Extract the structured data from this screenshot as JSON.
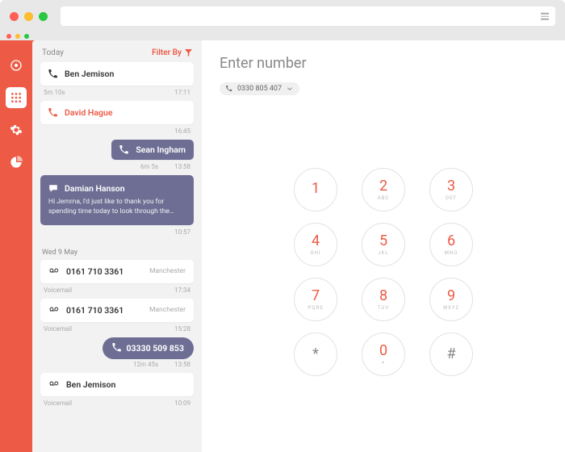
{
  "browser": {
    "url": ""
  },
  "colors": {
    "accent": "#ed5a45",
    "purple": "#6e6e94"
  },
  "nav": {
    "items": [
      {
        "name": "logo-icon"
      },
      {
        "name": "dialpad-icon",
        "active": true
      },
      {
        "name": "gear-icon"
      },
      {
        "name": "chart-icon"
      }
    ]
  },
  "log": {
    "title": "Today",
    "filter_label": "Filter By",
    "sections": [
      {
        "label": "Today"
      },
      {
        "label": "Wed 9 May"
      }
    ],
    "items": [
      {
        "name": "Ben Jemison",
        "duration": "5m 10s",
        "time": "17:11",
        "kind": "out"
      },
      {
        "name": "David Hague",
        "time": "16:45",
        "kind": "missed"
      },
      {
        "name": "Sean Ingham",
        "duration": "6m 5s",
        "time": "13:58",
        "kind": "in"
      },
      {
        "name": "Damian Hanson",
        "body": "Hi Jemma, I'd just like to thank you for spending time today to look through the…",
        "time": "10:57",
        "kind": "msg"
      },
      {
        "number": "0161 710 3361",
        "location": "Manchester",
        "status": "Voicemail",
        "time": "17:34",
        "kind": "vm"
      },
      {
        "number": "0161 710 3361",
        "location": "Manchester",
        "status": "Voicemail",
        "time": "15:28",
        "kind": "vm"
      },
      {
        "number": "03330 509 853",
        "duration": "12m 45s",
        "time": "13:58",
        "kind": "pill"
      },
      {
        "name": "Ben Jemison",
        "status": "Voicemail",
        "time": "10:09",
        "kind": "vm-name"
      }
    ]
  },
  "dialer": {
    "title": "Enter number",
    "selected_number": "0330 805 407",
    "keys": [
      {
        "d": "1",
        "l": ""
      },
      {
        "d": "2",
        "l": "ABC"
      },
      {
        "d": "3",
        "l": "DEF"
      },
      {
        "d": "4",
        "l": "GHI"
      },
      {
        "d": "5",
        "l": "JKL"
      },
      {
        "d": "6",
        "l": "MNO"
      },
      {
        "d": "7",
        "l": "PQRS"
      },
      {
        "d": "8",
        "l": "TUV"
      },
      {
        "d": "9",
        "l": "WXYZ"
      },
      {
        "d": "*",
        "l": "",
        "sym": true
      },
      {
        "d": "0",
        "l": "+"
      },
      {
        "d": "#",
        "l": "",
        "sym": true
      }
    ]
  }
}
